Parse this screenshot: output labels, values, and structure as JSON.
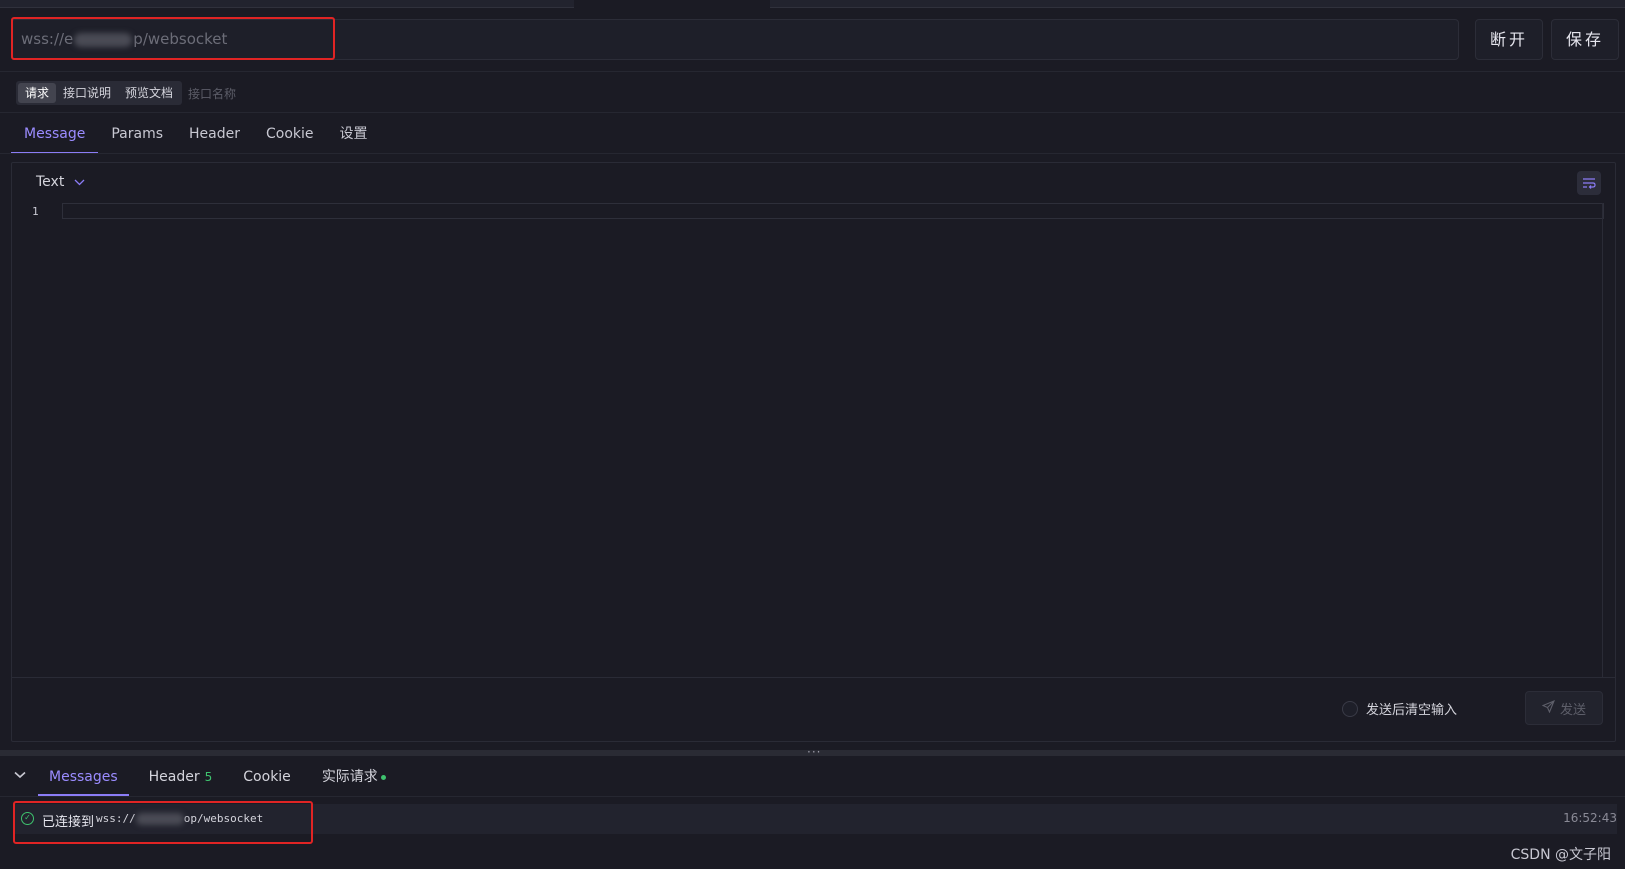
{
  "url": {
    "prefix": "wss://e",
    "suffix": "p/websocket"
  },
  "toolbar": {
    "disconnect_label": "断开",
    "save_label": "保存"
  },
  "subtabs": [
    {
      "label": "请求",
      "active": true
    },
    {
      "label": "接口说明",
      "active": false
    },
    {
      "label": "预览文档",
      "active": false
    }
  ],
  "subtab_hint": "接口名称",
  "main_tabs": [
    {
      "label": "Message",
      "active": true
    },
    {
      "label": "Params",
      "active": false
    },
    {
      "label": "Header",
      "active": false
    },
    {
      "label": "Cookie",
      "active": false
    },
    {
      "label": "设置",
      "active": false
    }
  ],
  "editor": {
    "type": "Text",
    "line_number": "1",
    "clear_after_send_label": "发送后清空输入",
    "send_label": "发送"
  },
  "bottom_tabs": [
    {
      "label": "Messages",
      "active": true
    },
    {
      "label": "Header",
      "badge": "5"
    },
    {
      "label": "Cookie"
    },
    {
      "label": "实际请求",
      "dot": true
    }
  ],
  "message": {
    "label": "已连接到",
    "url_prefix": "wss://",
    "url_suffix": "op/websocket",
    "time": "16:52:43"
  },
  "watermark": "CSDN @文子阳",
  "colors": {
    "accent": "#8b7cf6",
    "success": "#3ec26e",
    "annotation": "#e02424",
    "background": "#1b1b24"
  }
}
